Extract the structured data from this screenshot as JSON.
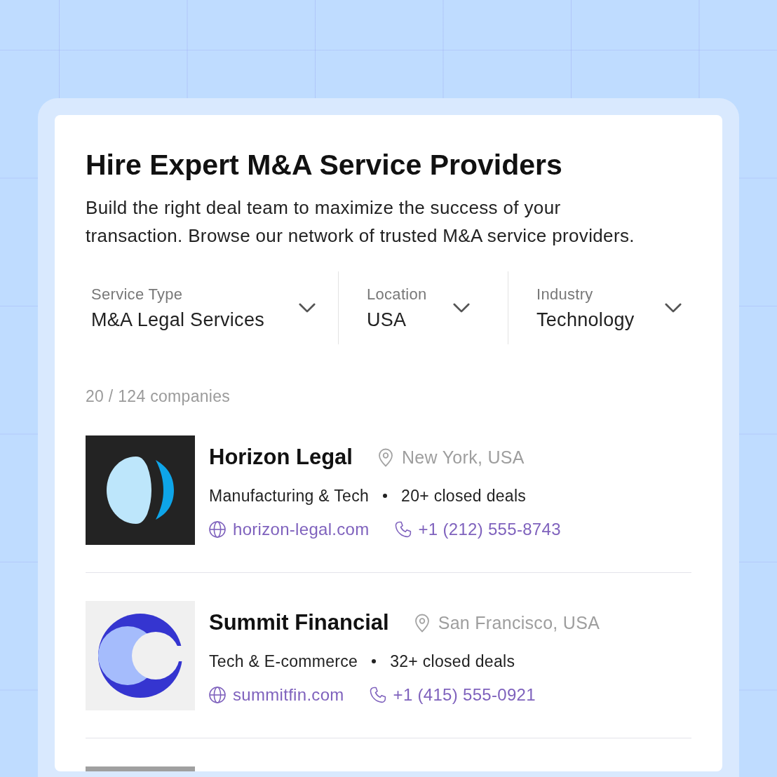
{
  "header": {
    "title": "Hire Expert M&A Service Providers",
    "description": "Build the right deal team to maximize the success of your transaction. Browse our network of trusted M&A service providers."
  },
  "filters": [
    {
      "label": "Service Type",
      "value": "M&A Legal Services"
    },
    {
      "label": "Location",
      "value": "USA"
    },
    {
      "label": "Industry",
      "value": "Technology"
    }
  ],
  "result_count": "20 / 124 companies",
  "companies": [
    {
      "kind": "lens",
      "name": "Horizon Legal",
      "location": "New York, USA",
      "sectors": "Manufacturing & Tech",
      "deals": "20+ closed deals",
      "website": "horizon-legal.com",
      "phone": "+1 (212) 555-8743"
    },
    {
      "kind": "ring",
      "name": "Summit Financial",
      "location": "San Francisco, USA",
      "sectors": "Tech & E-commerce",
      "deals": "32+ closed deals",
      "website": "summitfin.com",
      "phone": "+1 (415) 555-0921"
    },
    {
      "kind": "blank"
    }
  ]
}
